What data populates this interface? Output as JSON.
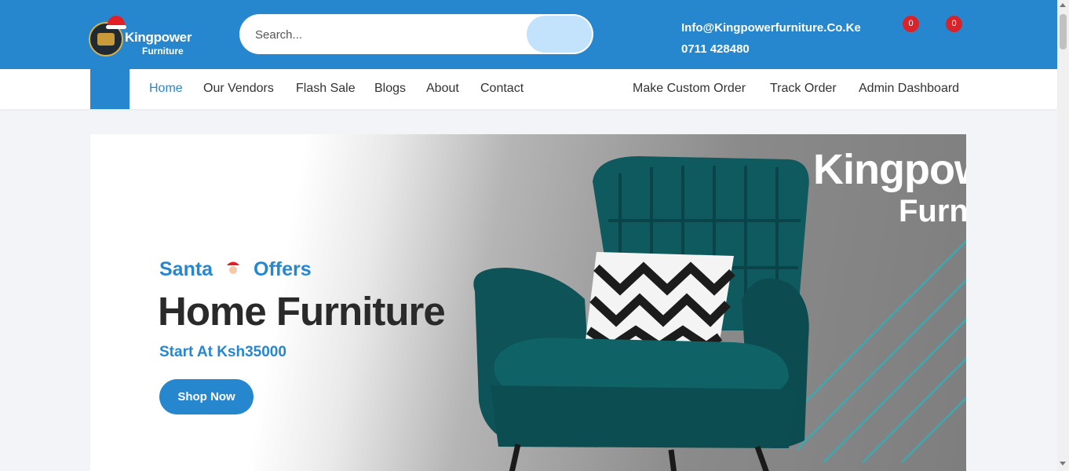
{
  "header": {
    "logo": {
      "line1": "Kingpower",
      "line2": "Furniture"
    },
    "search": {
      "placeholder": "Search..."
    },
    "email": "Info@Kingpowerfurniture.Co.Ke",
    "phone": "0711 428480",
    "wishlist_count": "0",
    "cart_count": "0"
  },
  "nav": {
    "left": [
      "Home",
      "Our Vendors",
      "Flash Sale",
      "Blogs",
      "About",
      "Contact"
    ],
    "right": [
      "Make Custom Order",
      "Track Order",
      "Admin Dashboard"
    ],
    "active": "Home"
  },
  "hero": {
    "kicker_left": "Santa",
    "kicker_right": "Offers",
    "title": "Home Furniture",
    "price": "Start At Ksh35000",
    "button": "Shop Now",
    "watermark_line1": "Kingpow",
    "watermark_line2": "Furn"
  },
  "colors": {
    "primary": "#2687cf",
    "badge": "#d9232b",
    "search_button": "#c3e2fb",
    "chair": "#0f5a5e"
  }
}
